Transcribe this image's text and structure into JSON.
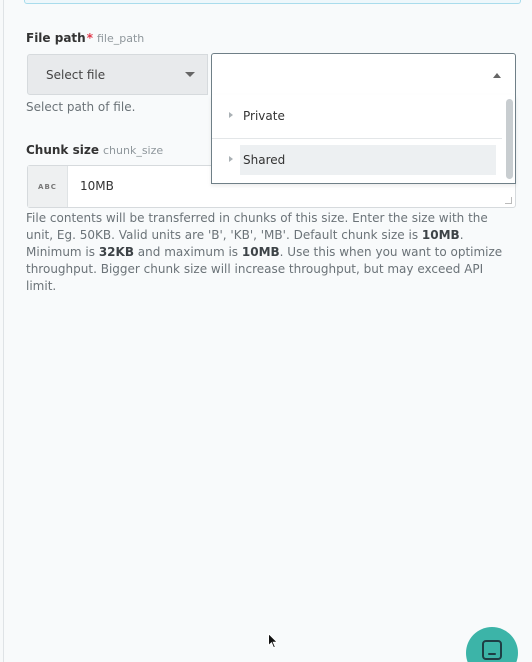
{
  "file_path": {
    "label": "File path",
    "required_mark": "*",
    "key": "file_path",
    "select_button_label": "Select file",
    "input_value": "",
    "hint": "Select path of file.",
    "dropdown_items": [
      {
        "label": "Private",
        "highlighted": false
      },
      {
        "label": "Shared",
        "highlighted": true
      }
    ]
  },
  "chunk_size": {
    "label": "Chunk size",
    "key": "chunk_size",
    "type_badge": "ABC",
    "value": "10MB",
    "hint_parts": {
      "p1": "File contents will be transferred in chunks of this size. Enter the size with the unit, Eg. 50KB. Valid units are 'B', 'KB', 'MB'. Default chunk size is ",
      "b1": "10MB",
      "p2": ". Minimum is ",
      "b2": "32KB",
      "p3": " and maximum is ",
      "b3": "10MB",
      "p4": ". Use this when you want to optimize throughput. Bigger chunk size will increase throughput, but may exceed API limit."
    }
  },
  "chat_widget": {
    "icon": "chat-icon"
  },
  "colors": {
    "accent": "#3cb4a8",
    "required": "#e0384b"
  }
}
